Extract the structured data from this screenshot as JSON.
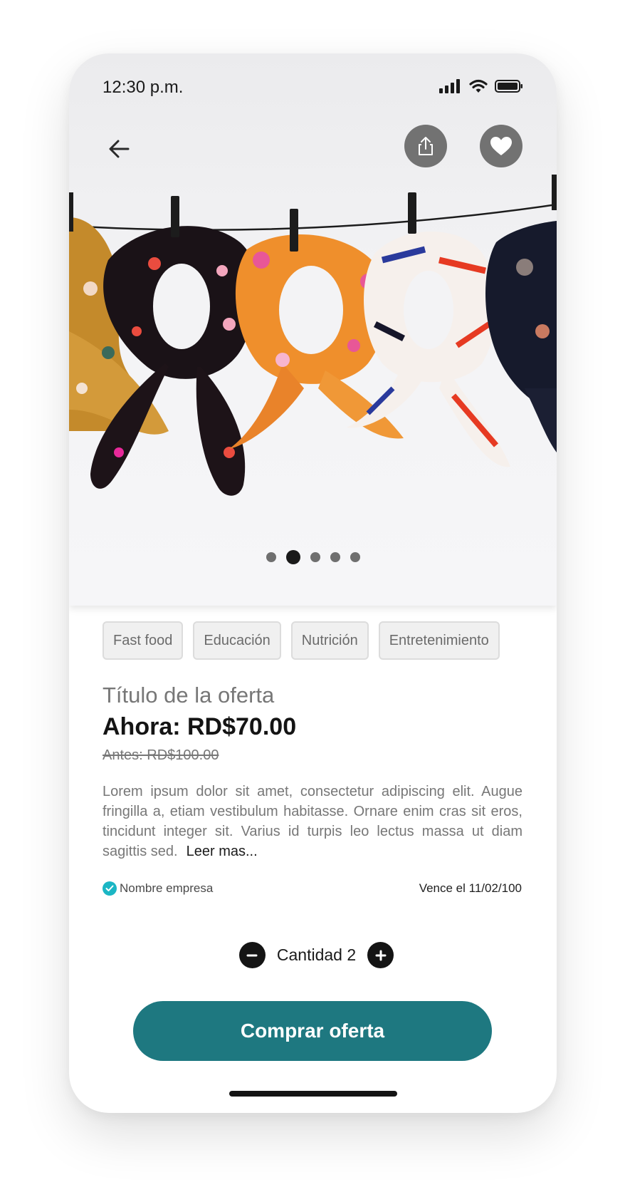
{
  "status_bar": {
    "time": "12:30 p.m."
  },
  "icons": {
    "back": "arrow-left-icon",
    "share": "share-icon",
    "favorite": "heart-icon",
    "verified": "check-circle-icon",
    "minus": "minus-icon",
    "plus": "plus-icon"
  },
  "carousel": {
    "total": 5,
    "active_index": 2
  },
  "categories": [
    "Fast food",
    "Educación",
    "Nutrición",
    "Entretenimiento"
  ],
  "offer": {
    "title": "Título de la oferta",
    "price_now": "Ahora: RD$70.00",
    "price_before": "Antes: RD$100.00",
    "description": "Lorem ipsum dolor sit amet, consectetur adipiscing elit. Augue fringilla a, etiam vestibulum habitasse. Ornare enim cras sit eros, tincidunt integer sit. Varius id turpis leo lectus massa ut diam sagittis sed.",
    "read_more": "Leer mas...",
    "company": "Nombre empresa",
    "expires": "Vence el 11/02/100"
  },
  "quantity": {
    "label": "Cantidad 2",
    "value": 2
  },
  "cta": {
    "label": "Comprar oferta"
  },
  "colors": {
    "primary": "#1e7880",
    "verified": "#1bb6c4",
    "icon_button_bg": "#727272",
    "text_dark": "#141414",
    "text_muted": "#777777"
  }
}
